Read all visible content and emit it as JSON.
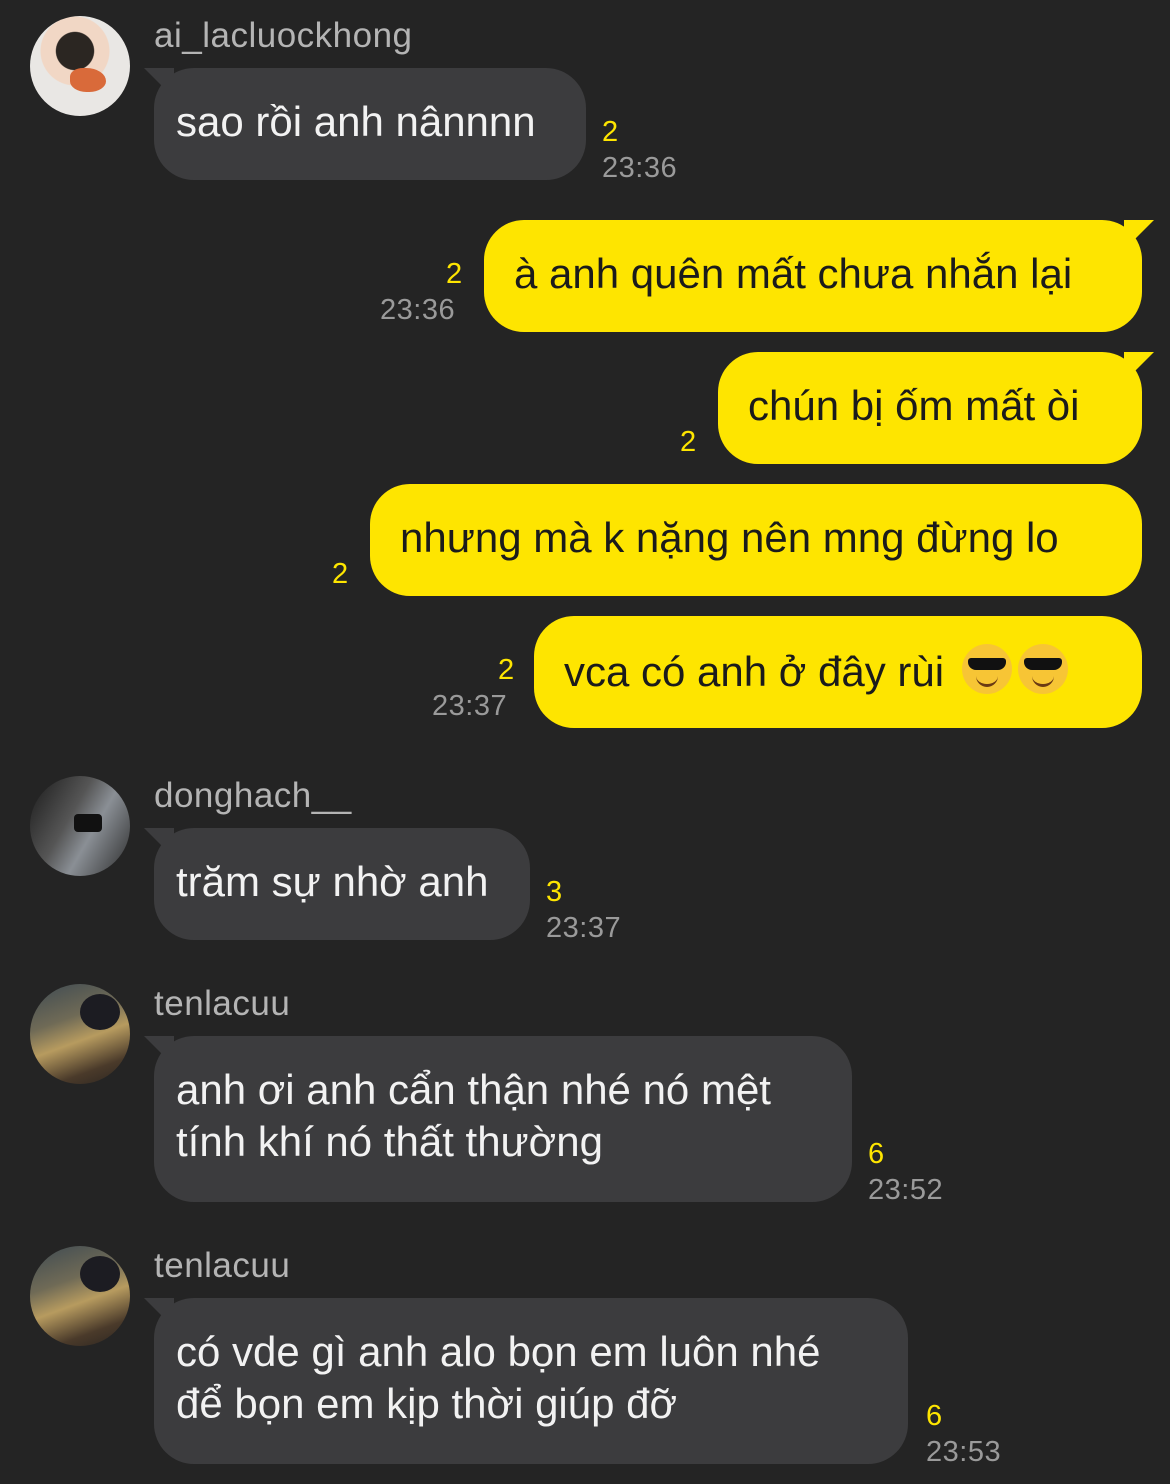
{
  "messages": [
    {
      "sender": "ai_lacluockhong",
      "text": "sao rồi anh nânnnn",
      "count": "2",
      "time": "23:36"
    },
    {
      "sender": "me",
      "text": "à anh quên mất chưa nhắn lại",
      "count": "2",
      "time": "23:36"
    },
    {
      "sender": "me",
      "text": "chún bị ốm mất òi",
      "count": "2"
    },
    {
      "sender": "me",
      "text": "nhưng mà k nặng nên mng đừng lo",
      "count": "2"
    },
    {
      "sender": "me",
      "text": "vca có anh ở đây rùi",
      "emojis": [
        "smiling-face-with-sunglasses",
        "smiling-face-with-sunglasses"
      ],
      "count": "2",
      "time": "23:37"
    },
    {
      "sender": "donghach__",
      "text": "trăm sự nhờ anh",
      "count": "3",
      "time": "23:37"
    },
    {
      "sender": "tenlacuu",
      "lines": [
        "anh ơi anh cẩn thận nhé nó mệt",
        "tính khí nó thất thường"
      ],
      "count": "6",
      "time": "23:52"
    },
    {
      "sender": "tenlacuu",
      "lines": [
        "có vde gì anh alo bọn em luôn nhé",
        "để bọn em kịp thời giúp đỡ"
      ],
      "count": "6",
      "time": "23:53"
    }
  ],
  "colors": {
    "background": "#242424",
    "incoming_bubble": "#3c3c3e",
    "outgoing_bubble": "#fee500",
    "unread_count": "#fee500",
    "timestamp": "#9a9a9a"
  }
}
